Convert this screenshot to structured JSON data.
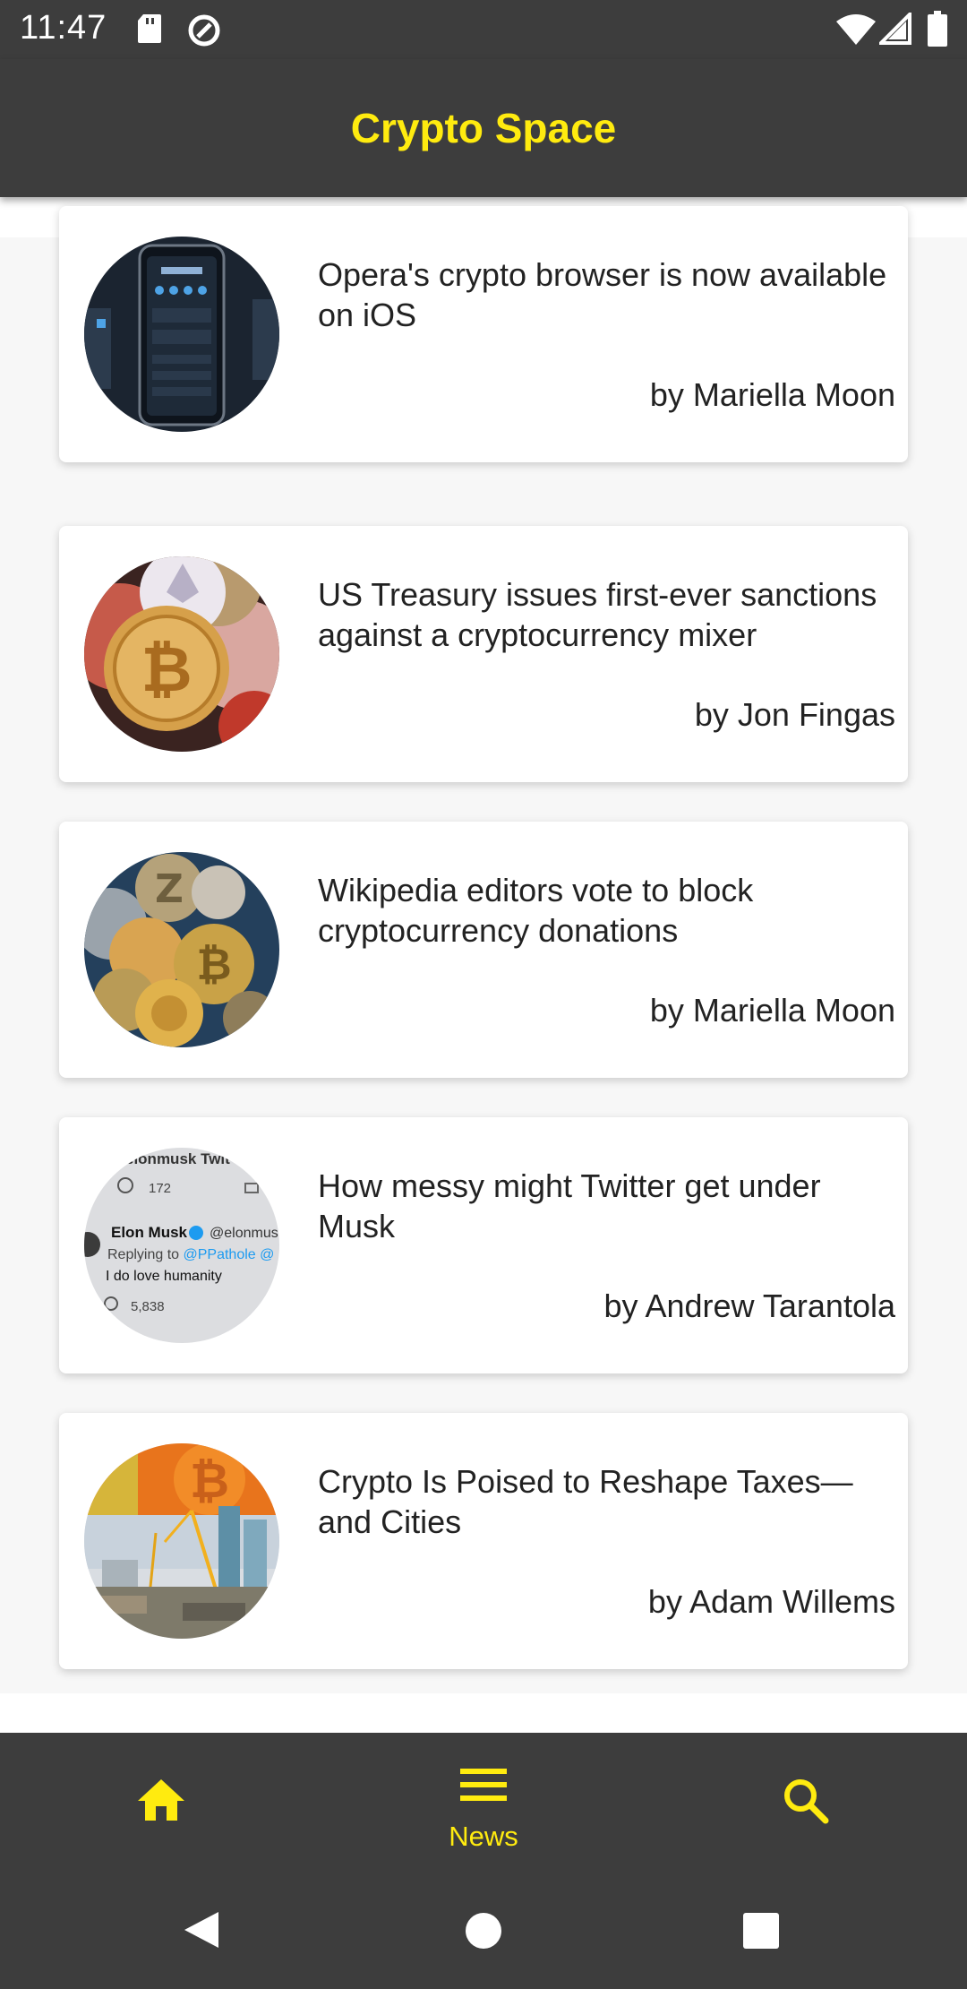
{
  "status_bar": {
    "time": "11:47",
    "left_icons": [
      "sd-card-icon",
      "data-saver-icon"
    ],
    "right_icons": [
      "wifi-icon",
      "signal-icon",
      "battery-icon"
    ]
  },
  "app_bar": {
    "title": "Crypto Space"
  },
  "articles": [
    {
      "title": "Opera's crypto browser is now available on iOS",
      "author": "by Mariella Moon",
      "thumbnail": "phone-screenshot-image"
    },
    {
      "title": "US Treasury issues first-ever sanctions against a cryptocurrency mixer",
      "author": "by Jon Fingas",
      "thumbnail": "crypto-coins-image"
    },
    {
      "title": "Wikipedia editors vote to block cryptocurrency donations",
      "author": "by Mariella Moon",
      "thumbnail": "coin-pile-image"
    },
    {
      "title": "How messy might Twitter get under Musk",
      "author": "by Andrew Tarantola",
      "thumbnail": "tweet-screenshot-image"
    },
    {
      "title": "Crypto Is Poised to Reshape Taxes—and Cities",
      "author": "by Adam Willems",
      "thumbnail": "city-bitcoin-image"
    }
  ],
  "bottom_nav": {
    "items": [
      {
        "icon": "home-icon",
        "label": ""
      },
      {
        "icon": "menu-icon",
        "label": "News",
        "selected": true
      },
      {
        "icon": "search-icon",
        "label": ""
      }
    ]
  },
  "tweet_thumb": {
    "header": "elonmusk Twit",
    "replies": "172",
    "name": "Elon Musk",
    "handle": "@elonmus",
    "replying_prefix": "Replying to ",
    "replying_to": "@PPathole @",
    "text": "I do love humanity",
    "likes": "5,838"
  },
  "colors": {
    "bar_bg": "#3d3d3d",
    "accent": "#ffeb0f",
    "card_bg": "#ffffff"
  }
}
